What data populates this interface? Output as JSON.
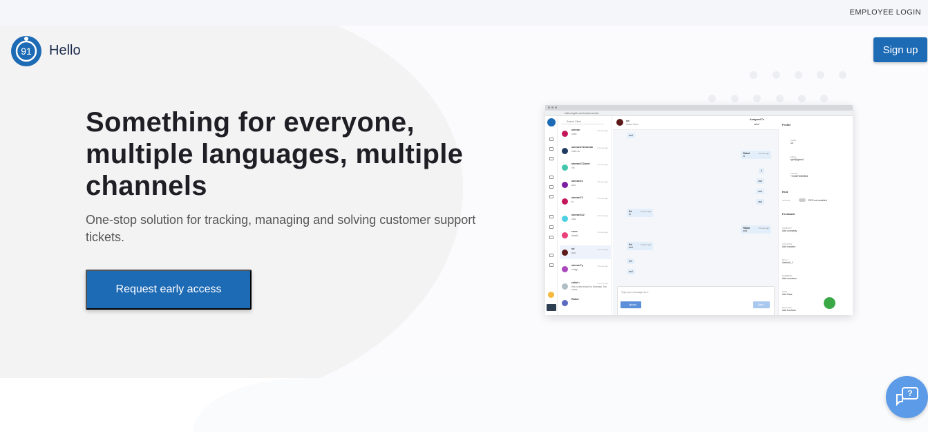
{
  "topbar": {
    "employee_login": "EMPLOYEE LOGIN"
  },
  "header": {
    "logo_text": "91",
    "brand": "Hello",
    "signup_label": "Sign up"
  },
  "hero": {
    "headline": "Something for everyone, multiple languages, multiple channels",
    "subtext": "One-stop solution for tracking, managing and solving customer support tickets.",
    "cta_label": "Request early access"
  },
  "screenshot": {
    "url": "hello.msg91.com/contact-center",
    "search_placeholder": "Search Client",
    "chat_header": {
      "name": "sd",
      "status": "Active Now",
      "assigned_label": "Assigned To",
      "assignee": "rahul"
    },
    "contacts": [
      {
        "name": "simran",
        "msg": "hello",
        "time": "2 hours ago",
        "color": "#c2185b"
      },
      {
        "name": "simran272simran",
        "msg": "hello ok",
        "time": "2 hours ago",
        "color": "#1e3a5f"
      },
      {
        "name": "simran272user",
        "msg": "HE",
        "time": "3 hours ago",
        "color": "#43c6ac"
      },
      {
        "name": "simran2x",
        "msg": "asd",
        "time": "4 hours ago",
        "color": "#7b1fa2"
      },
      {
        "name": "simran72",
        "msg": "hi",
        "time": "4 hours ago",
        "color": "#c2185b"
      },
      {
        "name": "simran312",
        "msg": "now",
        "time": "4 hours ago",
        "color": "#4dd0e1"
      },
      {
        "name": "rrrrrr",
        "msg": "dsada",
        "time": "4 hours ago",
        "color": "#ec407a"
      },
      {
        "name": "sd",
        "msg": "asd",
        "time": "4 hours ago",
        "color": "#5d1a1a"
      },
      {
        "name": "simran7y",
        "msg": "zhdgj",
        "time": "4 hours ago",
        "color": "#ab47bc"
      },
      {
        "name": "rahul r",
        "msg": "this is test email for thematic The show..",
        "time": "4 hours ago",
        "color": "#b0bec5"
      },
      {
        "name": "Rahul",
        "msg": "",
        "time": "",
        "color": "#5c6bc0"
      }
    ],
    "messages": [
      {
        "text": "asd"
      },
      {
        "sender": "Rahul",
        "text": "hi",
        "time": "4 hours ago"
      },
      {
        "text": "d"
      },
      {
        "text": "asd"
      },
      {
        "text": "asd"
      },
      {
        "text": "asd"
      },
      {
        "sender": "Sd",
        "text": "hi",
        "time": "4 hours ago"
      },
      {
        "sender": "Rahul",
        "text": "asd",
        "time": "4 hours ago"
      },
      {
        "sender": "Sd",
        "text": "asd",
        "time": "4 hours ago"
      },
      {
        "text": "DS"
      },
      {
        "text": "asd"
      }
    ],
    "input_placeholder": "Type your message here...",
    "upload_label": "Upload",
    "send_label": "Send",
    "profile": {
      "title": "Profile",
      "fields": [
        {
          "label": "NAME",
          "value": "sd"
        },
        {
          "label": "EMAIL",
          "value": "fgh9@gmail"
        },
        {
          "label": "PHONE",
          "value": "+918876489564"
        }
      ],
      "rcs_label": "RCS",
      "status_label": "STATUS",
      "rcs_status": "RCS not enabled",
      "feedback_label": "Feedback",
      "extra_fields": [
        {
          "label": "COMPANY",
          "value": "Add company"
        },
        {
          "label": "LOCATION",
          "value": "Add location"
        },
        {
          "label": "BALL 1",
          "value": "Aaeball_1"
        },
        {
          "label": "NUMBERS",
          "value": "Add numbers"
        },
        {
          "label": "DATE",
          "value": "Add Date"
        },
        {
          "label": "BOOLEAN",
          "value": "Add boolean"
        },
        {
          "label": "MOBILE",
          "value": ""
        }
      ]
    }
  },
  "colors": {
    "primary": "#1d6ab5",
    "help_button": "#5b9be8"
  },
  "help": {
    "icon": "chat-help-icon",
    "mark": "?"
  }
}
